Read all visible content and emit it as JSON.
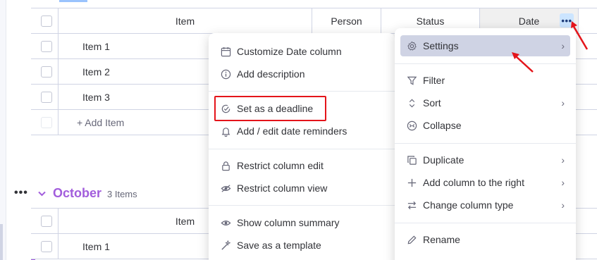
{
  "board": {
    "header": {
      "item": "Item",
      "person": "Person",
      "status": "Status",
      "date": "Date"
    },
    "group1": {
      "color": "#579bfc",
      "items": [
        "Item 1",
        "Item 2",
        "Item 3"
      ],
      "add_item": "+ Add Item"
    },
    "group2": {
      "color": "#a25ddc",
      "name": "October",
      "count": "3 Items",
      "header_item": "Item",
      "items": [
        "Item 1"
      ]
    }
  },
  "column_menu": {
    "items": [
      {
        "label": "Customize Date column",
        "icon": "calendar-icon"
      },
      {
        "label": "Add description",
        "icon": "info-icon"
      },
      {
        "label": "Set as a deadline",
        "icon": "check-circle-icon"
      },
      {
        "label": "Add / edit date reminders",
        "icon": "bell-icon"
      },
      {
        "label": "Restrict column edit",
        "icon": "lock-icon"
      },
      {
        "label": "Restrict column view",
        "icon": "eye-off-icon"
      },
      {
        "label": "Show column summary",
        "icon": "eye-icon"
      },
      {
        "label": "Save as a template",
        "icon": "magic-wand-icon"
      }
    ]
  },
  "main_menu": {
    "items": [
      {
        "label": "Settings",
        "icon": "gear-icon",
        "submenu": true
      },
      {
        "label": "Filter",
        "icon": "filter-icon",
        "submenu": false
      },
      {
        "label": "Sort",
        "icon": "sort-icon",
        "submenu": true
      },
      {
        "label": "Collapse",
        "icon": "collapse-icon",
        "submenu": false
      },
      {
        "label": "Duplicate",
        "icon": "duplicate-icon",
        "submenu": true
      },
      {
        "label": "Add column to the right",
        "icon": "plus-icon",
        "submenu": true
      },
      {
        "label": "Change column type",
        "icon": "swap-icon",
        "submenu": true
      },
      {
        "label": "Rename",
        "icon": "pencil-icon",
        "submenu": false
      }
    ]
  },
  "highlight_color": "#e4141a"
}
